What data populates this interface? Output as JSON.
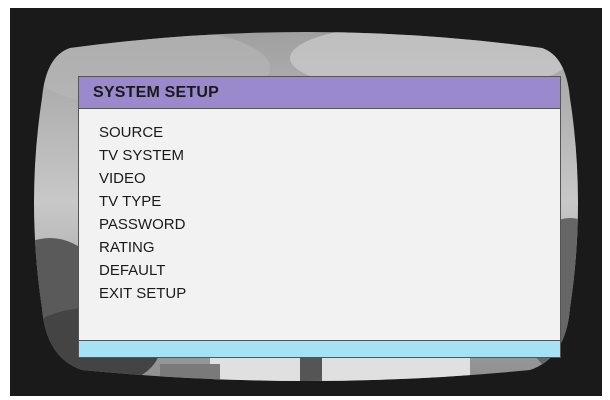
{
  "menu": {
    "title": "SYSTEM SETUP",
    "items": [
      {
        "label": "SOURCE"
      },
      {
        "label": "TV SYSTEM"
      },
      {
        "label": "VIDEO"
      },
      {
        "label": "TV TYPE"
      },
      {
        "label": "PASSWORD"
      },
      {
        "label": "RATING"
      },
      {
        "label": "DEFAULT"
      },
      {
        "label": "EXIT SETUP"
      }
    ]
  },
  "colors": {
    "title_bar": "#9a89cc",
    "status_bar": "#a6e2f5",
    "panel_bg": "#f2f2f2",
    "frame_bg": "#1a1a1a"
  }
}
